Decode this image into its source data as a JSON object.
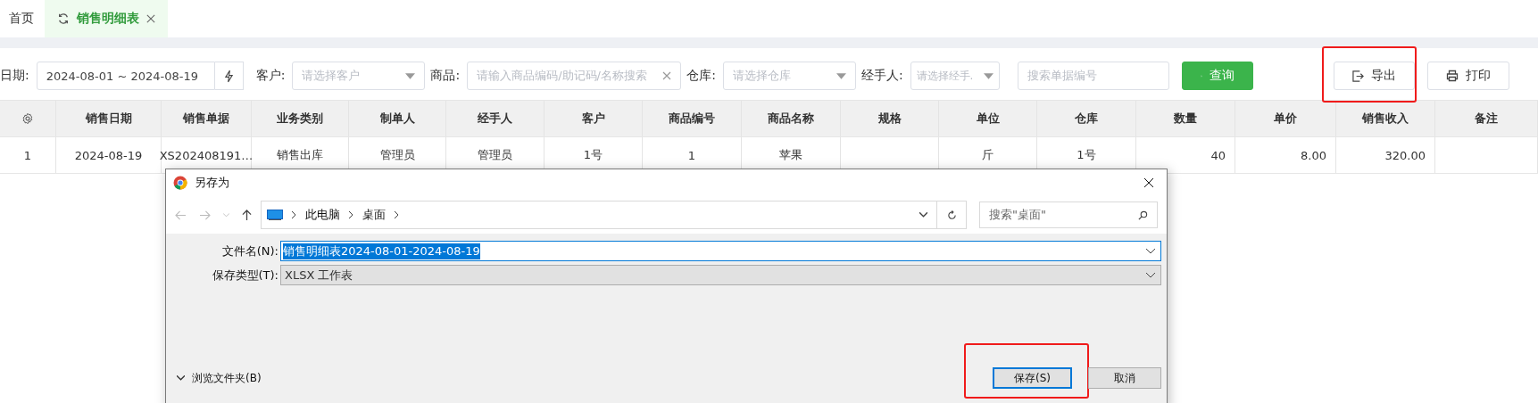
{
  "tabs": [
    {
      "label": "首页",
      "selected": false
    },
    {
      "label": "销售明细表",
      "selected": true
    }
  ],
  "filters": [
    {
      "kind": "date",
      "label": "日期:",
      "value": "2024-08-01 ~ 2024-08-19"
    },
    {
      "kind": "select",
      "label": "客户:",
      "placeholder": "请选择客户"
    },
    {
      "kind": "text",
      "label": "商品:",
      "placeholder": "请输入商品编码/助记码/名称搜索"
    },
    {
      "kind": "select",
      "label": "仓库:",
      "placeholder": "请选择仓库"
    },
    {
      "kind": "select",
      "label": "经手人:",
      "placeholder": "请选择经手."
    }
  ],
  "search": {
    "placeholder": "搜索单据编号"
  },
  "buttons": [
    {
      "kind": "query",
      "label": "查询"
    },
    {
      "kind": "export",
      "label": "导出",
      "highlighted": true
    },
    {
      "kind": "print",
      "label": "打印"
    }
  ],
  "table": {
    "columns": [
      "销售日期",
      "销售单据",
      "业务类别",
      "制单人",
      "经手人",
      "客户",
      "商品编号",
      "商品名称",
      "规格",
      "单位",
      "仓库",
      "数量",
      "单价",
      "销售收入",
      "备注"
    ],
    "rows": [
      {
        "index": "1",
        "cells": [
          "2024-08-19",
          "XS202408191…",
          "销售出库",
          "管理员",
          "管理员",
          "1号",
          "1",
          "苹果",
          "",
          "斤",
          "1号",
          "40",
          "8.00",
          "320.00",
          ""
        ]
      }
    ]
  },
  "dialog": {
    "title": "另存为",
    "path": [
      "此电脑",
      "桌面"
    ],
    "search_placeholder": "搜索\"桌面\"",
    "fields": [
      {
        "kind": "input",
        "label": "文件名(N):",
        "value": "销售明细表2024-08-01-2024-08-19"
      },
      {
        "kind": "dropdown",
        "label": "保存类型(T):",
        "value": "XLSX 工作表"
      }
    ],
    "browse": "浏览文件夹(B)",
    "buttons": [
      {
        "kind": "primary",
        "label": "保存(S)",
        "highlighted": true
      },
      {
        "kind": "secondary",
        "label": "取消",
        "highlighted": false
      }
    ]
  }
}
